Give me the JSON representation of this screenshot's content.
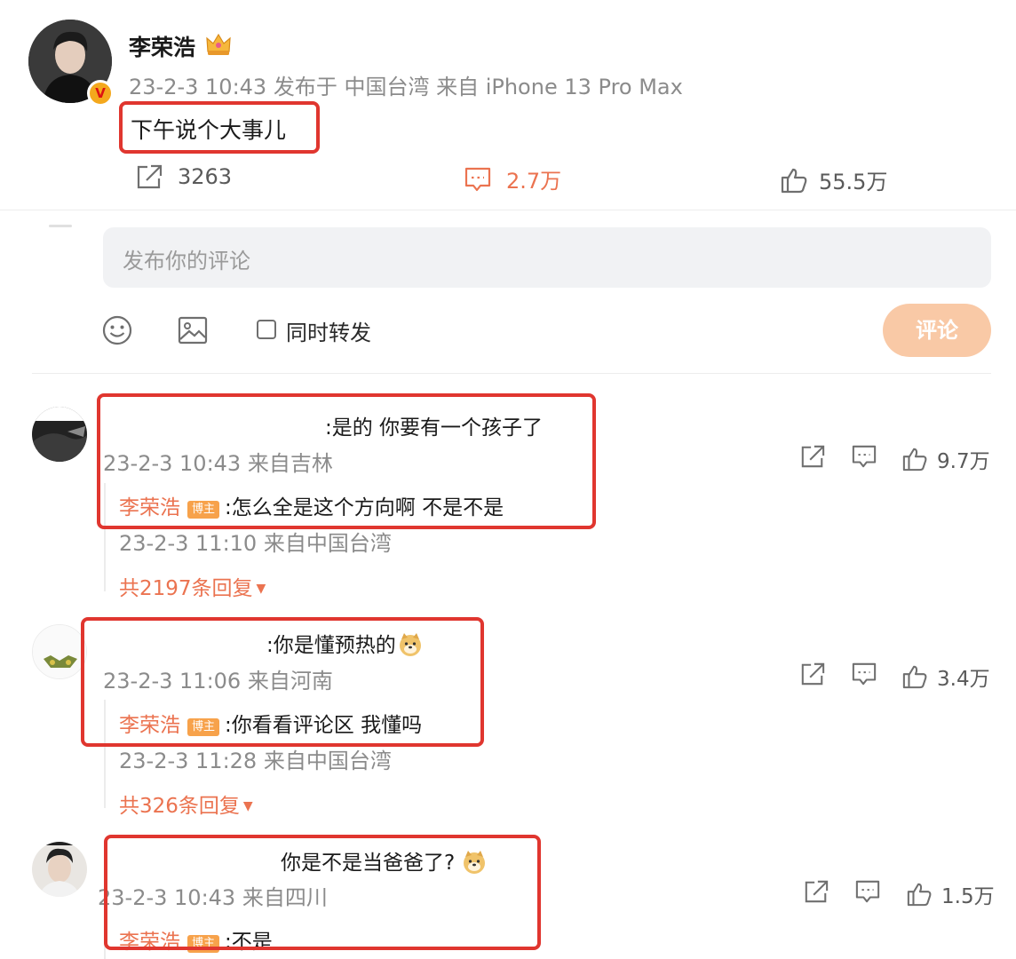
{
  "post": {
    "author": "李荣浩",
    "crown_icon": "crown-icon",
    "verified_badge": "V",
    "meta": "23-2-3 10:43 发布于 中国台湾 来自 iPhone 13 Pro Max",
    "content": "下午说个大事儿",
    "stats": {
      "repost": "3263",
      "comments": "2.7万",
      "likes": "55.5万"
    }
  },
  "composer": {
    "placeholder": "发布你的评论",
    "also_repost_label": "同时转发",
    "submit_label": "评论",
    "submit_color": "#f9c9a6"
  },
  "comments": [
    {
      "text": ":是的 你要有一个孩子了",
      "meta": "23-2-3 10:43 来自吉林",
      "likes": "9.7万",
      "reply": {
        "author": "李荣浩",
        "badge": "博主",
        "text": ":怎么全是这个方向啊 不是不是",
        "meta": "23-2-3 11:10 来自中国台湾"
      },
      "more_replies": "共2197条回复"
    },
    {
      "text": ":你是懂预热的",
      "meta": "23-2-3 11:06 来自河南",
      "likes": "3.4万",
      "reply": {
        "author": "李荣浩",
        "badge": "博主",
        "text": ":你看看评论区 我懂吗",
        "meta": "23-2-3 11:28 来自中国台湾"
      },
      "more_replies": "共326条回复"
    },
    {
      "text": "你是不是当爸爸了?",
      "meta": "23-2-3 10:43 来自四川",
      "likes": "1.5万",
      "reply": {
        "author": "李荣浩",
        "badge": "博主",
        "text": ":不是"
      }
    }
  ],
  "colors": {
    "accent": "#eb7350",
    "highlight_box": "#e0362f",
    "badge": "#f7a24b"
  }
}
